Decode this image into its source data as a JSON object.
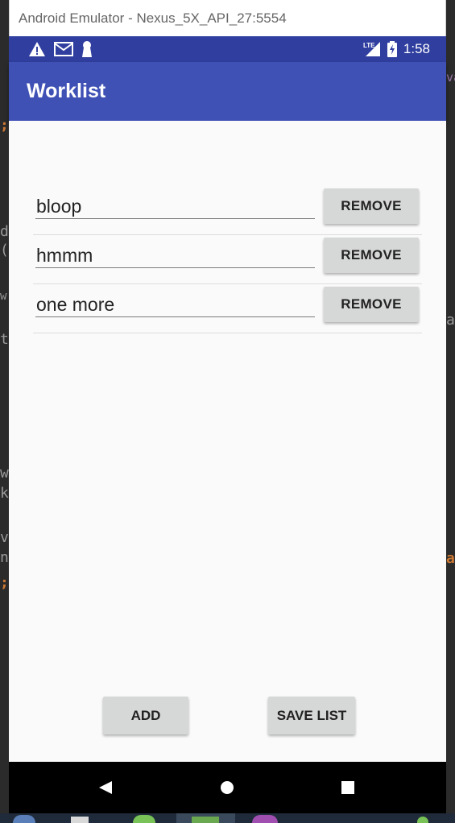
{
  "window": {
    "title": "Android Emulator - Nexus_5X_API_27:5554"
  },
  "status_bar": {
    "time": "1:58",
    "network": "LTE"
  },
  "app_bar": {
    "title": "Worklist"
  },
  "items": [
    {
      "text": "bloop",
      "remove_label": "REMOVE"
    },
    {
      "text": "hmmm",
      "remove_label": "REMOVE"
    },
    {
      "text": "one more",
      "remove_label": "REMOVE"
    }
  ],
  "actions": {
    "add_label": "ADD",
    "save_label": "SAVE LIST"
  },
  "colors": {
    "status_bar": "#303f9f",
    "app_bar": "#3f51b5",
    "button": "#d6d7d7",
    "background": "#fafafa"
  },
  "icons": {
    "status_left": [
      "warning-icon",
      "mail-icon",
      "keyhole-icon"
    ],
    "status_right": [
      "lte-signal-icon",
      "battery-charging-icon"
    ],
    "nav": [
      "back-icon",
      "home-icon",
      "recents-icon"
    ]
  }
}
